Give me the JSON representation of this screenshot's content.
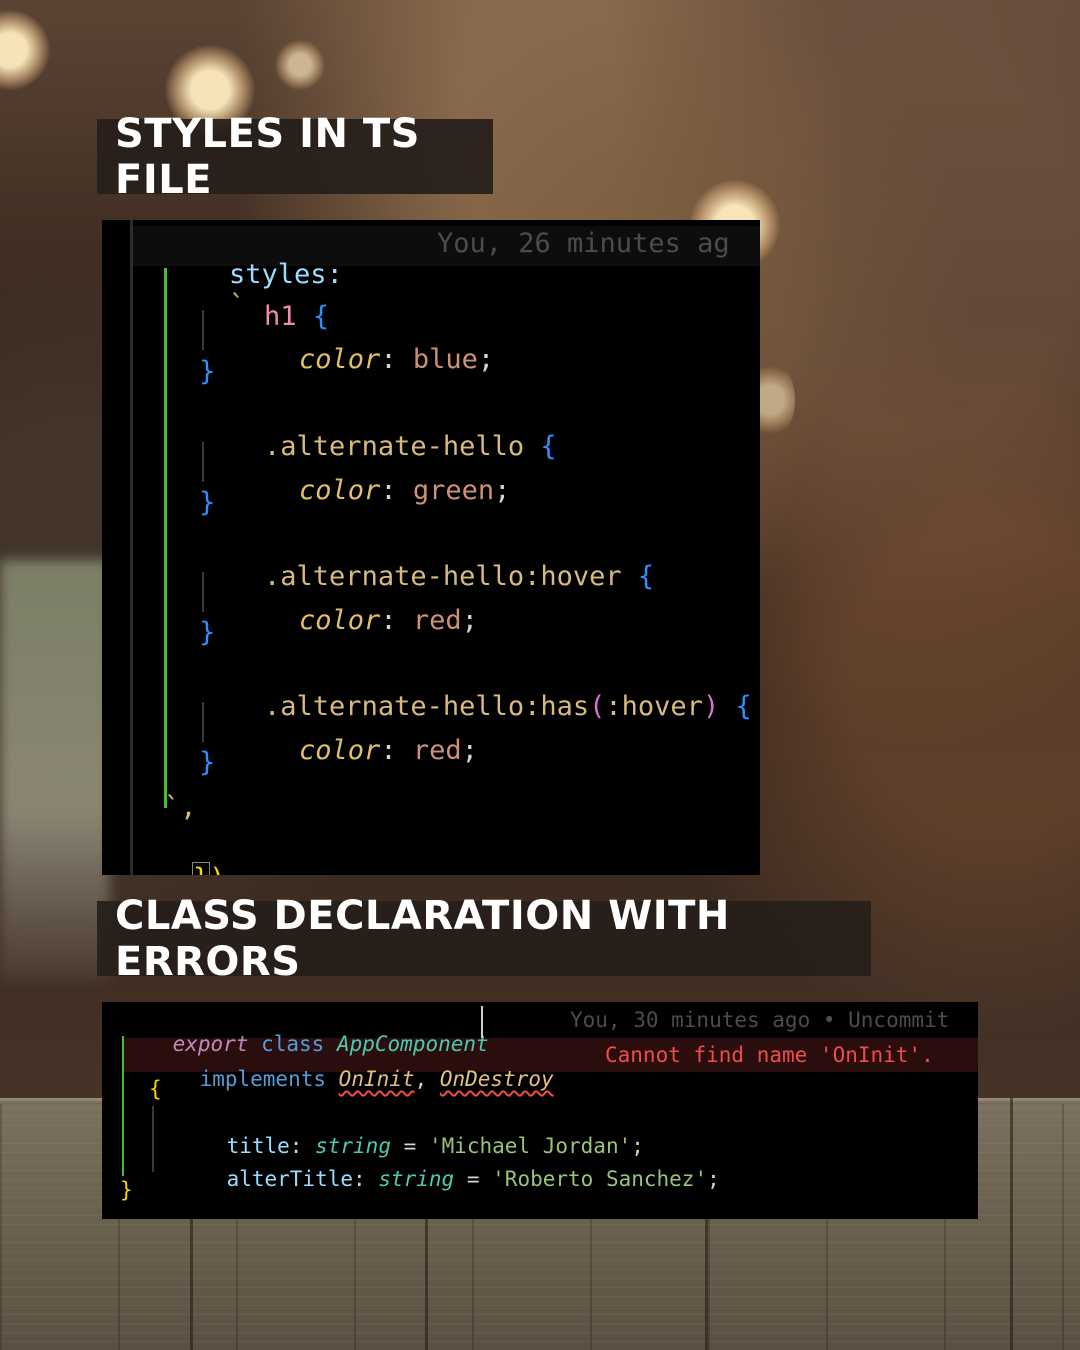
{
  "headings": {
    "styles_title": "STYLES IN TS FILE",
    "class_title": "CLASS DECLARATION WITH ERRORS"
  },
  "styles_code": {
    "styles_key": "styles:",
    "backtick": "`",
    "blame": "You, 26 minutes ag",
    "h1_selector": "h1",
    "brace_open": "{",
    "brace_close": "}",
    "prop": "color",
    "colon": ":",
    "semicolon": ";",
    "value_blue": "blue",
    "alt_selector": ".alternate-hello",
    "value_green": "green",
    "hover_selector": ".alternate-hello:hover",
    "value_red": "red",
    "has_selector_start": ".alternate-hello:has",
    "paren_open": "(",
    "has_inner": ":hover",
    "paren_close": ")",
    "end_template": "`,",
    "close_brace": "}",
    "close_paren": ")"
  },
  "class_code": {
    "export_kw": "export",
    "class_kw": "class",
    "class_name": "AppComponent",
    "blame": "You, 30 minutes ago • Uncommit",
    "implements_kw": "implements",
    "iface1": "OnInit",
    "comma": ",",
    "iface2": "OnDestroy",
    "error_msg": "Cannot find name 'OnInit'.",
    "open_brace": "{",
    "title_prop": "title",
    "colon": ":",
    "type_string": "string",
    "equals": "=",
    "title_value": "'Michael Jordan'",
    "semicolon": ";",
    "alt_prop": "alterTitle",
    "alt_value": "'Roberto Sanchez'",
    "close_brace": "}"
  }
}
